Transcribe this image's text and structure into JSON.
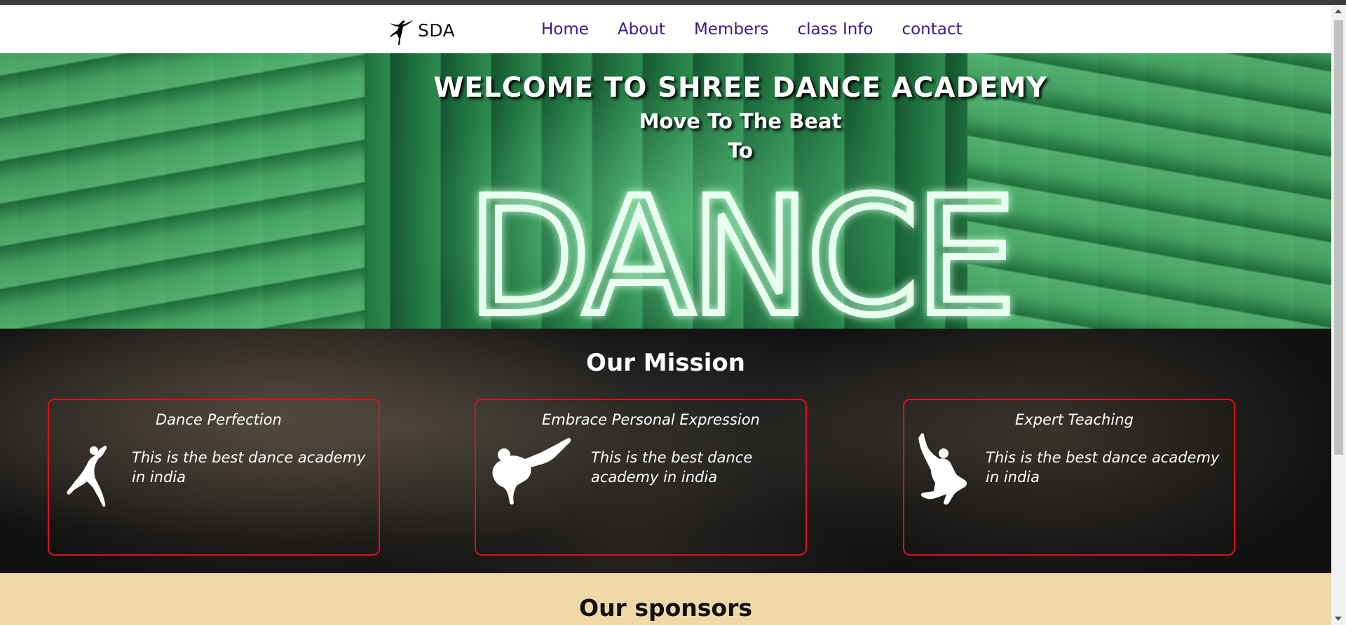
{
  "nav": {
    "logo_text": "SDA",
    "logo_icon": "ballerina-icon",
    "links": [
      "Home",
      "About",
      "Members",
      "class Info",
      "contact"
    ],
    "link_color": "#3a1a8c"
  },
  "hero": {
    "title": "WELCOME TO SHREE DANCE ACADEMY",
    "subtitle": "Move To The Beat",
    "to_text": "To",
    "neon_word": "DANCE"
  },
  "mission": {
    "title": "Our Mission",
    "border_color": "#e0101a",
    "cards": [
      {
        "title": "Dance Perfection",
        "text": "This is the best dance academy in india",
        "icon": "dancer-flip-icon"
      },
      {
        "title": "Embrace Personal Expression",
        "text": "This is the best dance academy in india",
        "icon": "breakdancer-icon"
      },
      {
        "title": "Expert Teaching",
        "text": "This is the best dance academy in india",
        "icon": "dancer-jump-icon"
      }
    ]
  },
  "sponsors": {
    "title": "Our sponsors",
    "background": "#efd8a8"
  }
}
